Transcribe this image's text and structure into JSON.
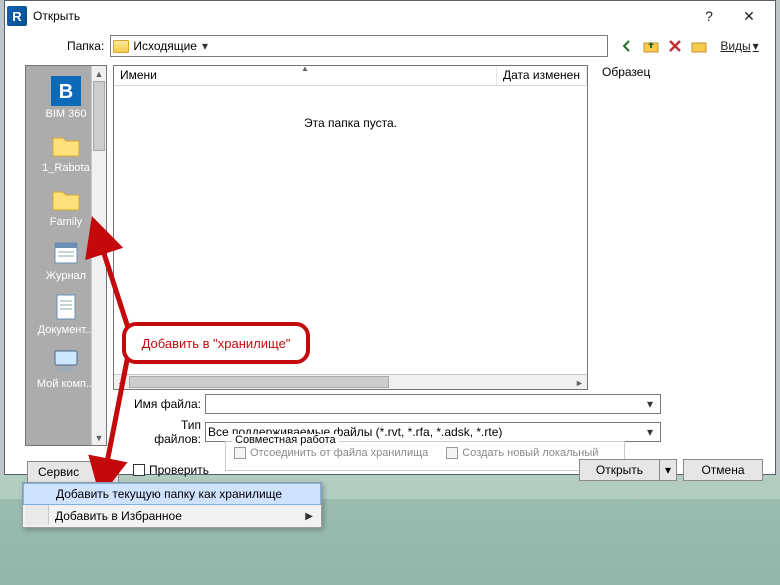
{
  "window": {
    "title": "Открыть",
    "app_icon_letter": "R"
  },
  "folder_row": {
    "label": "Папка:",
    "selected": "Исходящие",
    "views_label": "Виды"
  },
  "places": [
    {
      "label": "BIM 360",
      "icon": "bim"
    },
    {
      "label": "1_Rabota",
      "icon": "folder"
    },
    {
      "label": "Family",
      "icon": "folder"
    },
    {
      "label": "Журнал",
      "icon": "journal"
    },
    {
      "label": "Документ...",
      "icon": "doc"
    },
    {
      "label": "Мой комп...",
      "icon": "pc"
    }
  ],
  "list": {
    "col_name": "Имени",
    "col_date": "Дата изменен",
    "empty_msg": "Эта папка пуста."
  },
  "sample_label": "Образец",
  "fields": {
    "filename_label": "Имя файла:",
    "filename_value": "",
    "filetype_label": "Тип файлов:",
    "filetype_value": "Все поддерживаемые файлы  (*.rvt, *.rfa, *.adsk, *.rte)"
  },
  "team": {
    "group": "Совместная работа",
    "opt1": "Отсоединить от файла хранилища",
    "opt2": "Создать новый локальный"
  },
  "buttons": {
    "tools": "Сервис",
    "check": "Проверить",
    "open": "Открыть",
    "cancel": "Отмена"
  },
  "menu": {
    "item1": "Добавить текущую папку как хранилище",
    "item2": "Добавить в Избранное"
  },
  "callout": "Добавить в \"хранилище\""
}
